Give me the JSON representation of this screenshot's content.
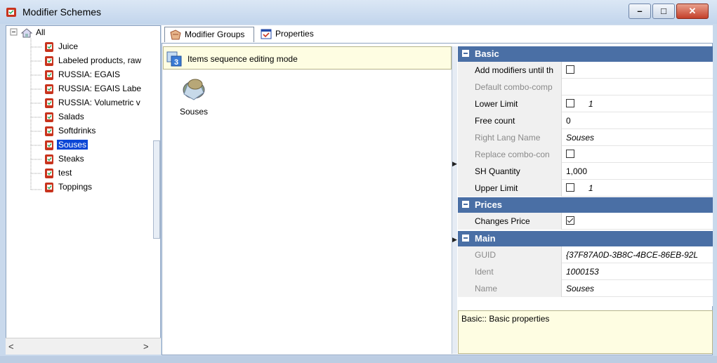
{
  "window": {
    "title": "Modifier Schemes"
  },
  "tree": {
    "root": "All",
    "items": [
      {
        "label": "Juice"
      },
      {
        "label": "Labeled products, raw"
      },
      {
        "label": "RUSSIA: EGAIS"
      },
      {
        "label": "RUSSIA: EGAIS Labe"
      },
      {
        "label": "RUSSIA: Volumetric v"
      },
      {
        "label": "Salads"
      },
      {
        "label": "Softdrinks"
      },
      {
        "label": "Souses",
        "selected": true
      },
      {
        "label": "Steaks"
      },
      {
        "label": "test"
      },
      {
        "label": "Toppings"
      }
    ],
    "scroll_left": "<",
    "scroll_right": ">"
  },
  "tabs": [
    {
      "label": "Modifier Groups",
      "active": true
    },
    {
      "label": "Properties",
      "active": false
    }
  ],
  "sequence_bar": {
    "text": "Items sequence editing mode"
  },
  "group_item": {
    "label": "Souses"
  },
  "properties": {
    "categories": {
      "basic": "Basic",
      "prices": "Prices",
      "main": "Main"
    },
    "basic_rows": [
      {
        "name": "Add modifiers until th",
        "value": "",
        "checkbox": true,
        "checked": false
      },
      {
        "name": "Default combo-comp",
        "value": "",
        "disabled": true
      },
      {
        "name": "Lower Limit",
        "value": "1",
        "checkbox": true,
        "checked": false,
        "italic": true
      },
      {
        "name": "Free count",
        "value": "0"
      },
      {
        "name": "Right Lang Name",
        "value": "Souses",
        "disabled": true,
        "italic": true
      },
      {
        "name": "Replace combo-con",
        "value": "",
        "checkbox": true,
        "checked": false,
        "disabled": true
      },
      {
        "name": "SH Quantity",
        "value": "1,000"
      },
      {
        "name": "Upper Limit",
        "value": "1",
        "checkbox": true,
        "checked": false,
        "italic": true
      }
    ],
    "prices_rows": [
      {
        "name": "Changes Price",
        "value": "",
        "checkbox": true,
        "checked": true
      }
    ],
    "main_rows": [
      {
        "name": "GUID",
        "value": "{37F87A0D-3B8C-4BCE-86EB-92L",
        "disabled": true,
        "italic": true
      },
      {
        "name": "Ident",
        "value": "1000153",
        "disabled": true,
        "italic": true
      },
      {
        "name": "Name",
        "value": "Souses",
        "disabled": true,
        "italic": true
      }
    ]
  },
  "help": {
    "text": "Basic:: Basic properties"
  },
  "colors": {
    "category_header": "#4a6fa5",
    "selection": "#0a46d6",
    "info_bg": "#fefde2"
  }
}
